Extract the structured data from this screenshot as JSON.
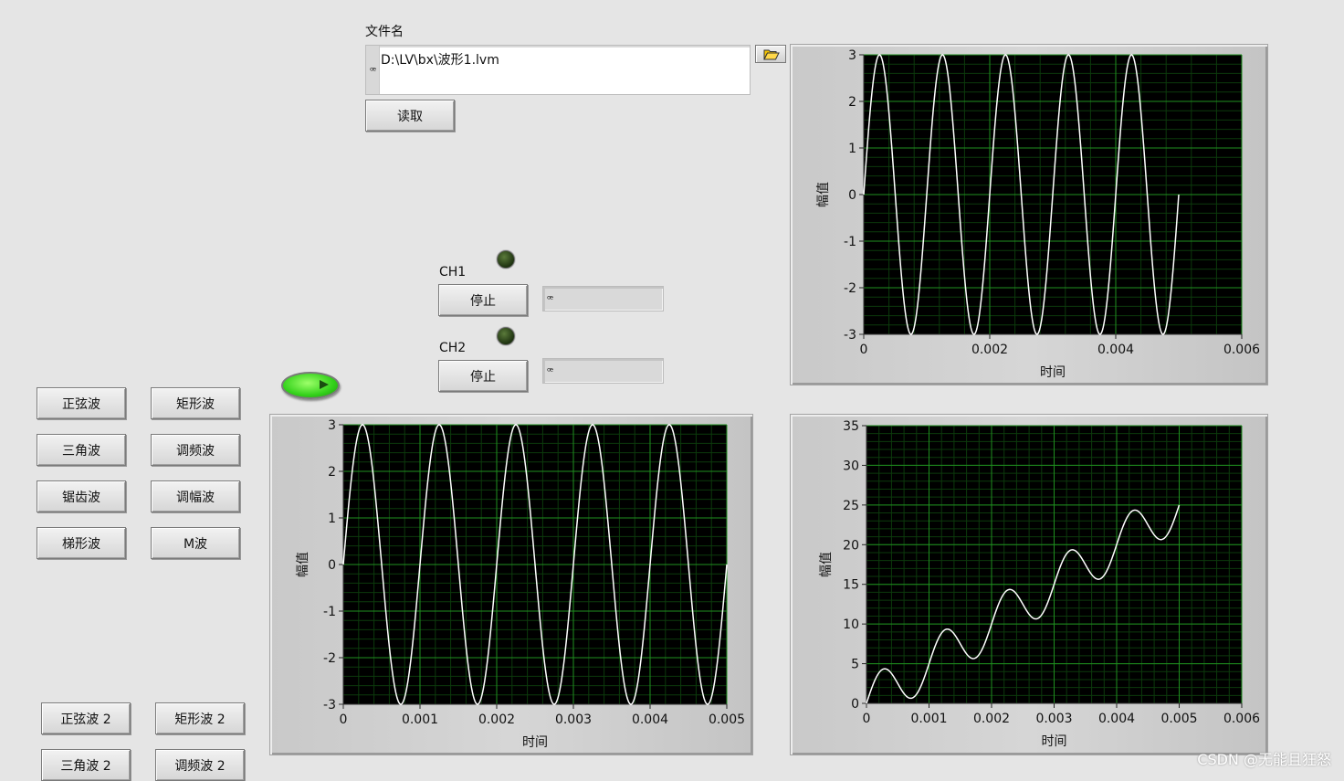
{
  "file": {
    "label": "文件名",
    "path": "D:\\LV\\bx\\波形1.lvm",
    "read_button": "读取"
  },
  "channels": [
    {
      "label": "CH1",
      "stop_button": "停止",
      "value": ""
    },
    {
      "label": "CH2",
      "stop_button": "停止",
      "value": ""
    }
  ],
  "wave_buttons": [
    "正弦波",
    "矩形波",
    "三角波",
    "调频波",
    "锯齿波",
    "调幅波",
    "梯形波",
    "M波"
  ],
  "wave_buttons_2": [
    "正弦波 2",
    "矩形波 2",
    "三角波 2",
    "调频波 2"
  ],
  "watermark": "CSDN @无能且狂怒",
  "chart_data": [
    {
      "type": "line",
      "xlabel": "时间",
      "ylabel": "幅值",
      "xlim": [
        0,
        0.006
      ],
      "ylim": [
        -3,
        3
      ],
      "x_ticks": [
        "0",
        "0.002",
        "0.004",
        "0.006"
      ],
      "y_ticks": [
        "3",
        "2",
        "1",
        "0",
        "-1",
        "-2",
        "-3"
      ],
      "grid": true,
      "series": [
        {
          "function": "sine",
          "amplitude": 3,
          "frequency_hz": 1000,
          "x_start": 0,
          "x_end": 0.005,
          "color": "#ffffff"
        }
      ]
    },
    {
      "type": "line",
      "xlabel": "时间",
      "ylabel": "幅值",
      "xlim": [
        0,
        0.005
      ],
      "ylim": [
        -3,
        3
      ],
      "x_ticks": [
        "0",
        "0.001",
        "0.002",
        "0.003",
        "0.004",
        "0.005"
      ],
      "y_ticks": [
        "3",
        "2",
        "1",
        "0",
        "-1",
        "-2",
        "-3"
      ],
      "grid": true,
      "series": [
        {
          "function": "sine",
          "amplitude": 3,
          "frequency_hz": 1000,
          "x_start": 0,
          "x_end": 0.005,
          "color": "#ffffff"
        }
      ]
    },
    {
      "type": "line",
      "xlabel": "时间",
      "ylabel": "幅值",
      "xlim": [
        0,
        0.006
      ],
      "ylim": [
        0,
        35
      ],
      "x_ticks": [
        "0",
        "0.001",
        "0.002",
        "0.003",
        "0.004",
        "0.005",
        "0.006"
      ],
      "y_ticks": [
        "35",
        "30",
        "25",
        "20",
        "15",
        "10",
        "5",
        "0"
      ],
      "grid": true,
      "series": [
        {
          "function": "ramp_plus_sine",
          "ramp_per_s": 5000,
          "amplitude": 3,
          "frequency_hz": 1000,
          "x_start": 0,
          "x_end": 0.005,
          "color": "#ffffff"
        }
      ]
    }
  ],
  "colors": {
    "plot_bg": "#000000",
    "grid_major": "#1f8f1f",
    "grid_minor": "#0c3a0c",
    "trace": "#ffffff",
    "panel_bg": "#e5e5e5"
  }
}
